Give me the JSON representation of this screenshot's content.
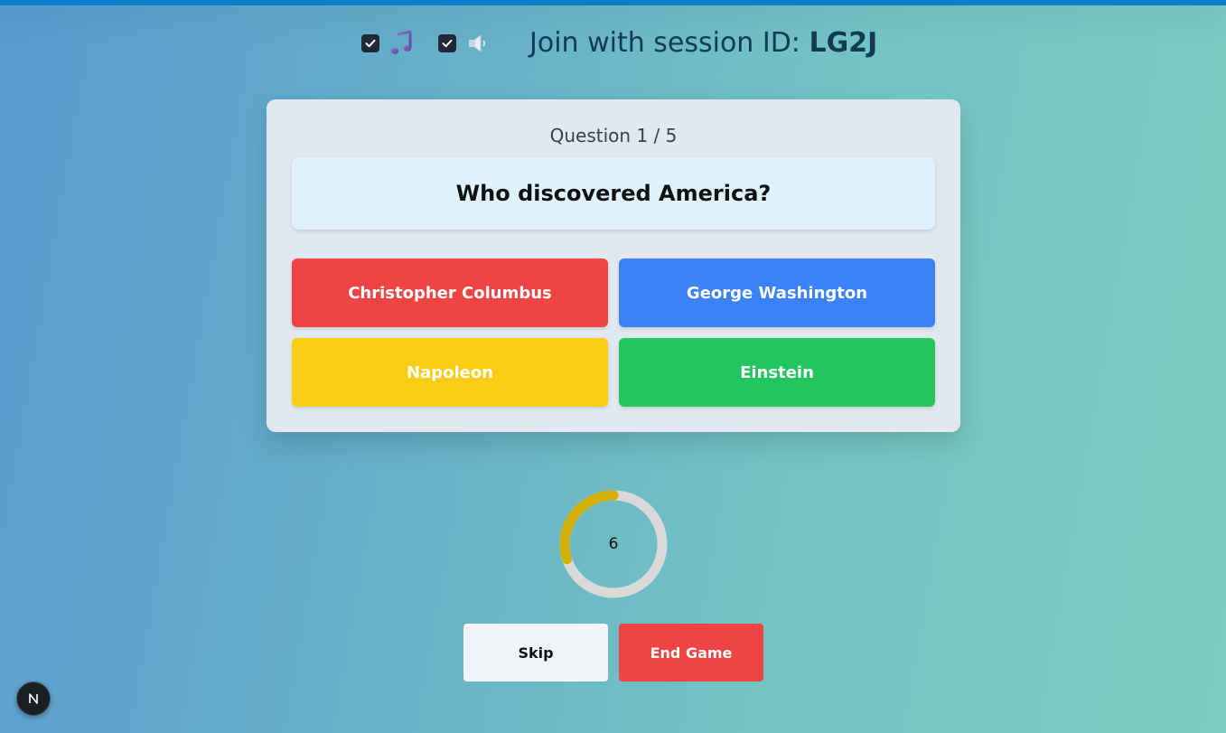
{
  "header": {
    "music_toggle": {
      "checked": true,
      "icon": "music-note-icon"
    },
    "sound_toggle": {
      "checked": true,
      "icon": "speaker-icon"
    },
    "session_prefix": "Join with session ID:",
    "session_id": "LG2J"
  },
  "question": {
    "counter": "Question 1 / 5",
    "text": "Who discovered America?"
  },
  "answers": [
    {
      "label": "Christopher Columbus",
      "color": "#ef4444"
    },
    {
      "label": "George Washington",
      "color": "#3b82f6"
    },
    {
      "label": "Napoleon",
      "color": "#facc15"
    },
    {
      "label": "Einstein",
      "color": "#22c55e"
    }
  ],
  "timer": {
    "value": "6",
    "remaining_fraction": 0.3,
    "color": "#d4b106",
    "track_color": "#d9d9d9"
  },
  "controls": {
    "skip_label": "Skip",
    "end_label": "End Game"
  },
  "badge": {
    "label": "N",
    "icon": "nextjs-logo-icon"
  }
}
